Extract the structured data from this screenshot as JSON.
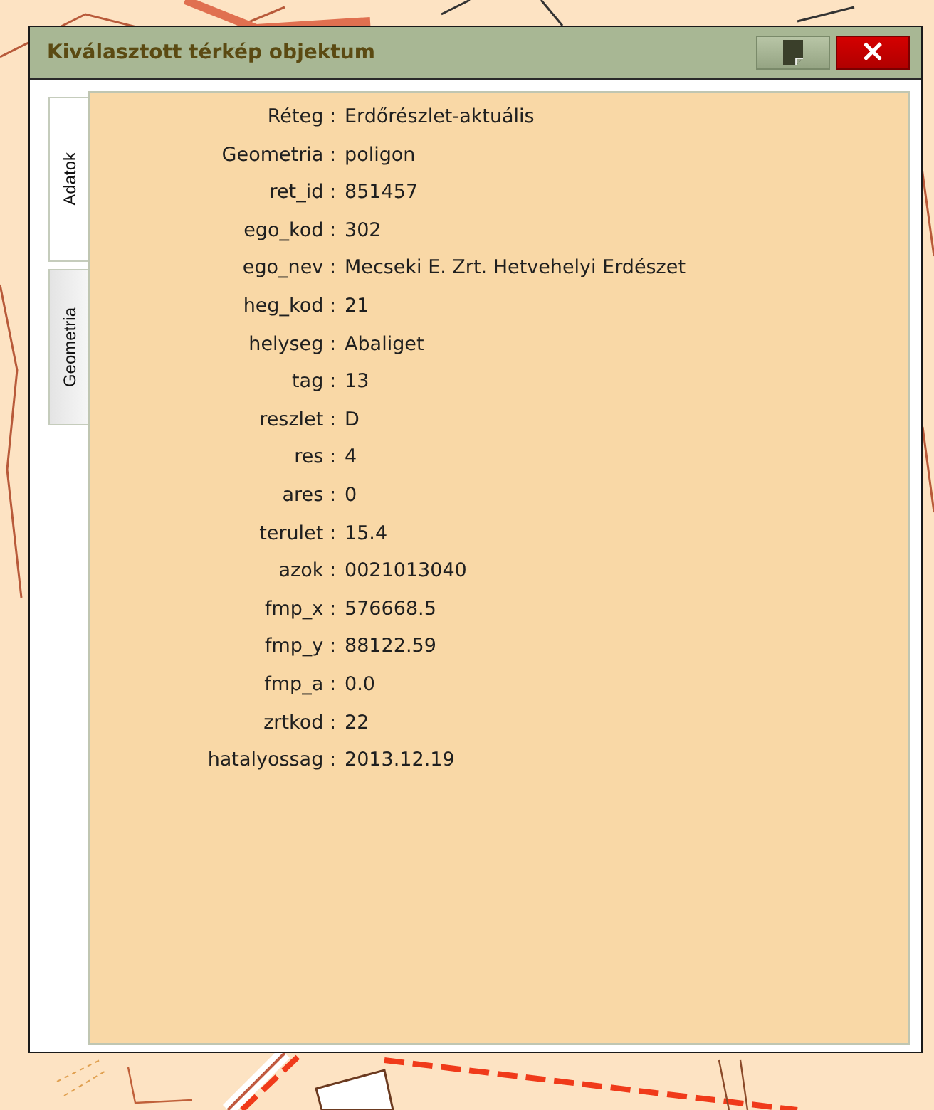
{
  "window": {
    "title": "Kiválasztott térkép objektum",
    "close_label": "×"
  },
  "tabs": [
    {
      "label": "Adatok",
      "selected": true
    },
    {
      "label": "Geometria",
      "selected": false
    }
  ],
  "attributes": [
    {
      "label": "Réteg :",
      "value": "Erdőrészlet-aktuális"
    },
    {
      "label": "Geometria :",
      "value": "poligon"
    },
    {
      "label": "ret_id :",
      "value": "851457"
    },
    {
      "label": "ego_kod :",
      "value": "302"
    },
    {
      "label": "ego_nev :",
      "value": "Mecseki E. Zrt. Hetvehelyi Erdészet"
    },
    {
      "label": "heg_kod :",
      "value": "21"
    },
    {
      "label": "helyseg :",
      "value": "Abaliget"
    },
    {
      "label": "tag :",
      "value": "13"
    },
    {
      "label": "reszlet :",
      "value": "D"
    },
    {
      "label": "res :",
      "value": "4"
    },
    {
      "label": "ares :",
      "value": "0"
    },
    {
      "label": "terulet :",
      "value": "15.4"
    },
    {
      "label": "azok :",
      "value": "0021013040"
    },
    {
      "label": "fmp_x :",
      "value": "576668.5"
    },
    {
      "label": "fmp_y :",
      "value": "88122.59"
    },
    {
      "label": "fmp_a :",
      "value": "0.0"
    },
    {
      "label": "zrtkod :",
      "value": "22"
    },
    {
      "label": "hatalyossag :",
      "value": "2013.12.19"
    }
  ]
}
